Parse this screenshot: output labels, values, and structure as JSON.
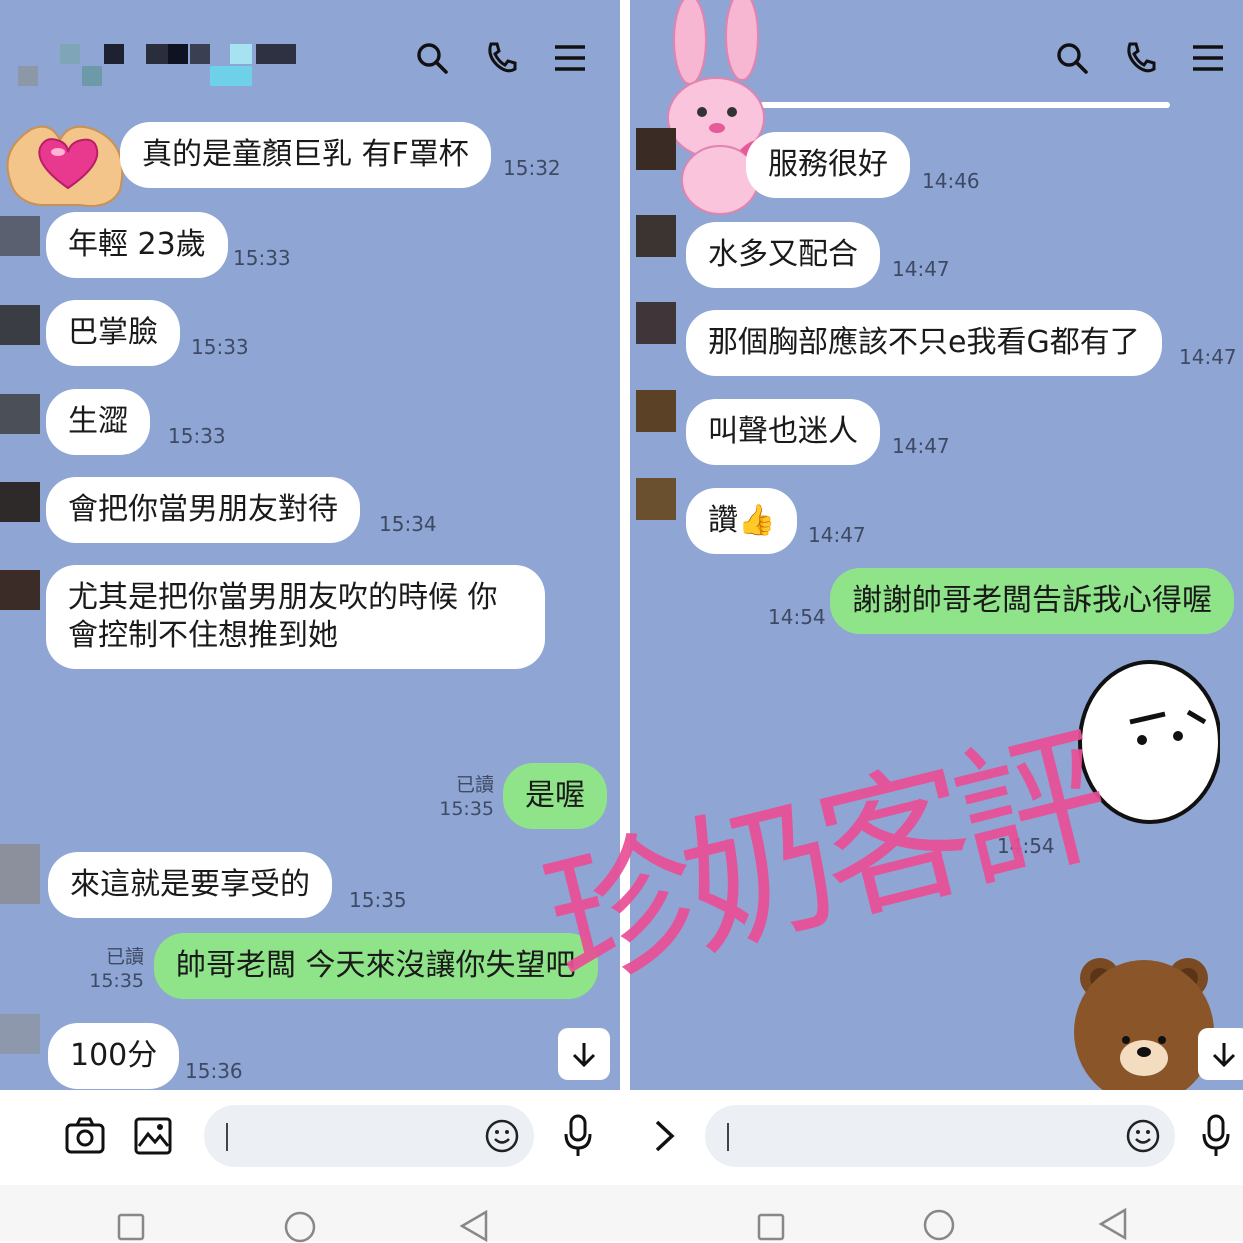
{
  "left": {
    "messages": [
      {
        "text": "真的是童顏巨乳 有F罩杯",
        "time": "15:32"
      },
      {
        "text": "年輕 23歲",
        "time": "15:33"
      },
      {
        "text": "巴掌臉",
        "time": "15:33"
      },
      {
        "text": "生澀",
        "time": "15:33"
      },
      {
        "text": "會把你當男朋友對待",
        "time": "15:34"
      },
      {
        "text": "尤其是把你當男朋友吹的時候 你會控制不住想推到她"
      },
      {
        "text": "是喔",
        "read": "已讀",
        "time": "15:35"
      },
      {
        "text": "來這就是要享受的",
        "time": "15:35"
      },
      {
        "text": "帥哥老闆 今天來沒讓你失望吧",
        "read": "已讀",
        "time": "15:35"
      },
      {
        "text": "100分",
        "time": "15:36"
      }
    ]
  },
  "right": {
    "messages": [
      {
        "text": "服務很好",
        "time": "14:46"
      },
      {
        "text": "水多又配合",
        "time": "14:47"
      },
      {
        "text": "那個胸部應該不只e我看G都有了",
        "time": "14:47"
      },
      {
        "text": "叫聲也迷人",
        "time": "14:47"
      },
      {
        "text": "讚",
        "time": "14:47"
      },
      {
        "text": "謝謝帥哥老闆告訴我心得喔",
        "time": "14:54"
      },
      {
        "sticker": "brown-bear-sticker",
        "time": "14:54"
      }
    ]
  },
  "watermark": "珍奶客評",
  "colors": {
    "chat_bg": "#8fa5d4",
    "bubble_in": "#ffffff",
    "bubble_out": "#8fe48a",
    "watermark": "#ea4f96"
  },
  "icons": [
    "search-icon",
    "phone-icon",
    "menu-icon",
    "camera-icon",
    "image-icon",
    "emoji-icon",
    "mic-icon",
    "chevron-right-icon",
    "arrow-down-icon"
  ]
}
